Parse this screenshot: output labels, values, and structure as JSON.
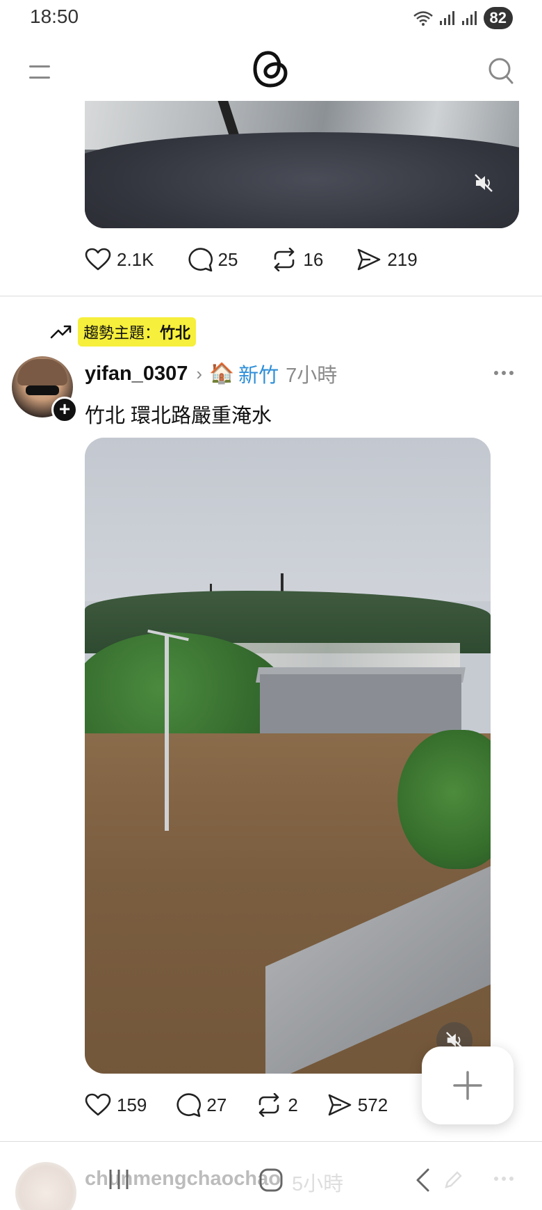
{
  "status_bar": {
    "time": "18:50",
    "battery": "82"
  },
  "post1": {
    "likes": "2.1K",
    "comments": "25",
    "reposts": "16",
    "shares": "219"
  },
  "trending": {
    "label": "趨勢主題：",
    "topic": "竹北"
  },
  "post2": {
    "username": "yifan_0307",
    "location_emoji": "🏠",
    "location": "新竹",
    "time": "7小時",
    "text": "竹北 環北路嚴重淹水",
    "likes": "159",
    "comments": "27",
    "reposts": "2",
    "shares": "572"
  },
  "next_post": {
    "username": "chunmengchaochao",
    "time": "5小時"
  },
  "colors": {
    "trend_highlight": "#f6ef3b",
    "location_link": "#2f8fd8"
  },
  "icons": [
    "menu-icon",
    "threads-logo",
    "search-icon",
    "mute-icon",
    "heart-icon",
    "comment-icon",
    "repost-icon",
    "share-icon",
    "trending-icon",
    "more-icon",
    "plus-icon"
  ]
}
